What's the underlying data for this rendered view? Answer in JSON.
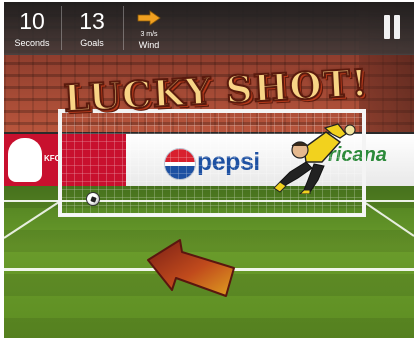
{
  "hud": {
    "seconds": {
      "value": "10",
      "label": "Seconds"
    },
    "goals": {
      "value": "13",
      "label": "Goals"
    },
    "wind": {
      "speed": "3 m/s",
      "label": "Wind",
      "icon": "arrow-right-icon"
    },
    "pause_icon": "pause-icon"
  },
  "banner": {
    "text": "LUCKY SHOT!"
  },
  "ads": {
    "kfc": "KFC",
    "pepsi": "pepsi",
    "tropicana": "ricana"
  },
  "colors": {
    "hud_bg": "#2b2b2b",
    "wind_arrow": "#f0a020",
    "banner_fill": "#f8d486",
    "banner_outline": "#5a1a0d",
    "keeper_shirt": "#f2d21e",
    "aim_arrow_top": "#7a1f16",
    "aim_arrow_bottom": "#e0a020",
    "pitch": "#5d8d22"
  },
  "icons": {
    "ball": "football-icon",
    "aim": "aim-arrow-icon",
    "goalkeeper": "goalkeeper-figure"
  }
}
